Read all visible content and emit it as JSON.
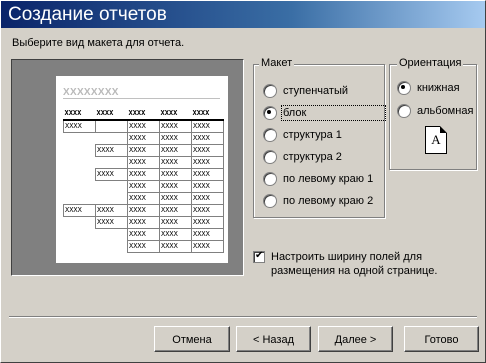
{
  "window": {
    "title": "Создание отчетов"
  },
  "instruction": "Выберите вид макета для отчета.",
  "preview": {
    "title": "XXXXXXXX",
    "header": [
      "XXXX",
      "XXXX",
      "XXXX",
      "XXXX",
      "XXXX"
    ],
    "rows": [
      [
        "XXXX",
        "",
        "XXXX",
        "XXXX",
        "XXXX"
      ],
      [
        "",
        "",
        "XXXX",
        "XXXX",
        "XXXX"
      ],
      [
        "",
        "XXXX",
        "XXXX",
        "XXXX",
        "XXXX"
      ],
      [
        "",
        "",
        "XXXX",
        "XXXX",
        "XXXX"
      ],
      [
        "",
        "XXXX",
        "XXXX",
        "XXXX",
        "XXXX"
      ],
      [
        "",
        "",
        "XXXX",
        "XXXX",
        "XXXX"
      ],
      [
        "",
        "",
        "XXXX",
        "XXXX",
        "XXXX"
      ],
      [
        "XXXX",
        "XXXX",
        "XXXX",
        "XXXX",
        "XXXX"
      ],
      [
        "",
        "XXXX",
        "XXXX",
        "XXXX",
        "XXXX"
      ],
      [
        "",
        "",
        "XXXX",
        "XXXX",
        "XXXX"
      ],
      [
        "",
        "",
        "XXXX",
        "XXXX",
        "XXXX"
      ]
    ]
  },
  "layout_group": {
    "label": "Макет",
    "options": [
      {
        "label": "ступенчатый",
        "selected": false
      },
      {
        "label": "блок",
        "selected": true
      },
      {
        "label": "структура 1",
        "selected": false
      },
      {
        "label": "структура 2",
        "selected": false
      },
      {
        "label": "по левому краю 1",
        "selected": false
      },
      {
        "label": "по левому краю 2",
        "selected": false
      }
    ]
  },
  "orientation_group": {
    "label": "Ориентация",
    "options": [
      {
        "label": "книжная",
        "selected": true
      },
      {
        "label": "альбомная",
        "selected": false
      }
    ],
    "icon_letter": "A"
  },
  "fit_checkbox": {
    "checked": true,
    "label": "Настроить ширину полей для размещения на одной странице."
  },
  "buttons": {
    "cancel": "Отмена",
    "back": "< Назад",
    "next": "Далее >",
    "finish": "Готово"
  }
}
